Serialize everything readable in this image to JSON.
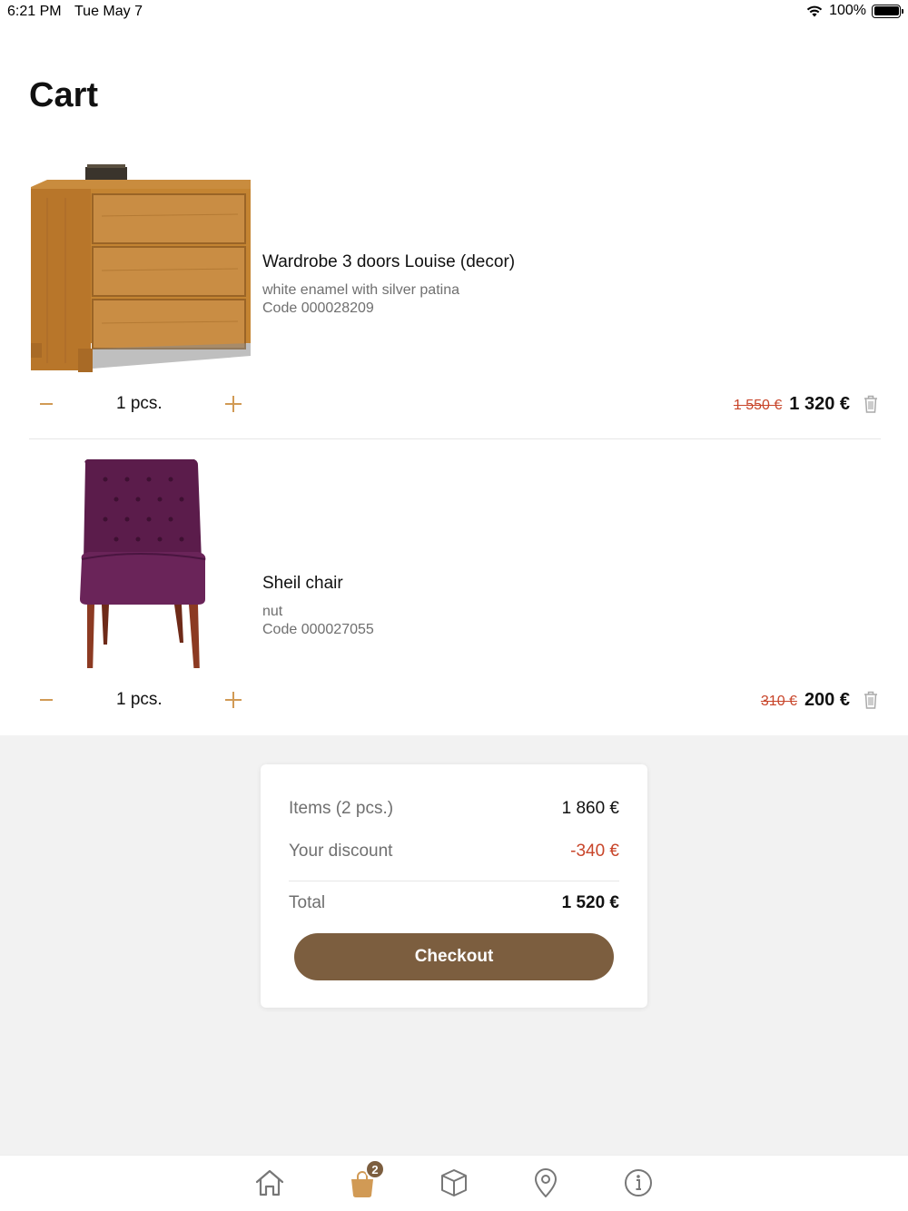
{
  "status_bar": {
    "time": "6:21 PM",
    "date": "Tue May 7",
    "battery": "100%",
    "battery_level": 1.0
  },
  "page": {
    "title": "Cart"
  },
  "cart": {
    "items": [
      {
        "name": "Wardrobe 3 doors Louise (decor)",
        "variant": "white enamel with silver patina",
        "code": "Code 000028209",
        "quantity": "1 pcs.",
        "old_price": "1 550 €",
        "price": "1 320 €",
        "image": "chest-of-drawers-image"
      },
      {
        "name": "Sheil chair",
        "variant": "nut",
        "code": "Code 000027055",
        "quantity": "1 pcs.",
        "old_price": "310 €",
        "price": "200 €",
        "image": "purple-chair-image"
      }
    ]
  },
  "summary": {
    "items_label": "Items (2 pcs.)",
    "items_value": "1 860 €",
    "discount_label": "Your discount",
    "discount_value": "-340 €",
    "total_label": "Total",
    "total_value": "1 520 €",
    "checkout_label": "Checkout"
  },
  "tab_bar": {
    "tabs": [
      {
        "icon": "home-icon"
      },
      {
        "icon": "shopping-bag-icon",
        "badge": "2"
      },
      {
        "icon": "box-icon"
      },
      {
        "icon": "location-pin-icon"
      },
      {
        "icon": "info-icon"
      }
    ]
  },
  "colors": {
    "accent": "#d19a55",
    "brand": "#7c5e3f",
    "discount": "#c8452a",
    "muted": "#6f6f6f"
  }
}
